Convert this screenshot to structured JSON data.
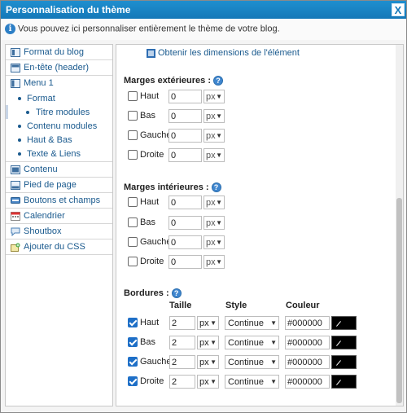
{
  "window": {
    "title": "Personnalisation du thème",
    "close_label": "X"
  },
  "info": {
    "text": "Vous pouvez ici personnaliser entièrement le thème de votre blog."
  },
  "sidebar": {
    "items": [
      {
        "label": "Format du blog",
        "icon": "layout-icon"
      },
      {
        "label": "En-tête (header)",
        "icon": "header-icon"
      },
      {
        "label": "Menu 1",
        "icon": "menu-icon"
      },
      {
        "label": "Format",
        "sub": true
      },
      {
        "label": "Titre modules",
        "sub": true,
        "active": true
      },
      {
        "label": "Contenu modules",
        "sub": true
      },
      {
        "label": "Haut & Bas",
        "sub": true
      },
      {
        "label": "Texte & Liens",
        "sub": true
      },
      {
        "label": "Contenu",
        "icon": "content-icon"
      },
      {
        "label": "Pied de page",
        "icon": "footer-icon"
      },
      {
        "label": "Boutons et champs",
        "icon": "buttons-icon"
      },
      {
        "label": "Calendrier",
        "icon": "calendar-icon"
      },
      {
        "label": "Shoutbox",
        "icon": "shoutbox-icon"
      },
      {
        "label": "Ajouter du CSS",
        "icon": "css-icon"
      }
    ]
  },
  "main": {
    "dimensions_link": "Obtenir les dimensions de l'élément",
    "outer_margins": {
      "title": "Marges extérieures :",
      "rows": [
        {
          "label": "Haut",
          "value": "0",
          "unit": "px",
          "checked": false
        },
        {
          "label": "Bas",
          "value": "0",
          "unit": "px",
          "checked": false
        },
        {
          "label": "Gauche",
          "value": "0",
          "unit": "px",
          "checked": false
        },
        {
          "label": "Droite",
          "value": "0",
          "unit": "px",
          "checked": false
        }
      ]
    },
    "inner_margins": {
      "title": "Marges intérieures :",
      "rows": [
        {
          "label": "Haut",
          "value": "0",
          "unit": "px",
          "checked": false
        },
        {
          "label": "Bas",
          "value": "0",
          "unit": "px",
          "checked": false
        },
        {
          "label": "Gauche",
          "value": "0",
          "unit": "px",
          "checked": false
        },
        {
          "label": "Droite",
          "value": "0",
          "unit": "px",
          "checked": false
        }
      ]
    },
    "borders": {
      "title": "Bordures :",
      "col_size": "Taille",
      "col_style": "Style",
      "col_color": "Couleur",
      "rows": [
        {
          "label": "Haut",
          "size": "2",
          "unit": "px",
          "style": "Continue",
          "color": "#000000",
          "checked": true
        },
        {
          "label": "Bas",
          "size": "2",
          "unit": "px",
          "style": "Continue",
          "color": "#000000",
          "checked": true
        },
        {
          "label": "Gauche",
          "size": "2",
          "unit": "px",
          "style": "Continue",
          "color": "#000000",
          "checked": true
        },
        {
          "label": "Droite",
          "size": "2",
          "unit": "px",
          "style": "Continue",
          "color": "#000000",
          "checked": true
        }
      ]
    }
  }
}
